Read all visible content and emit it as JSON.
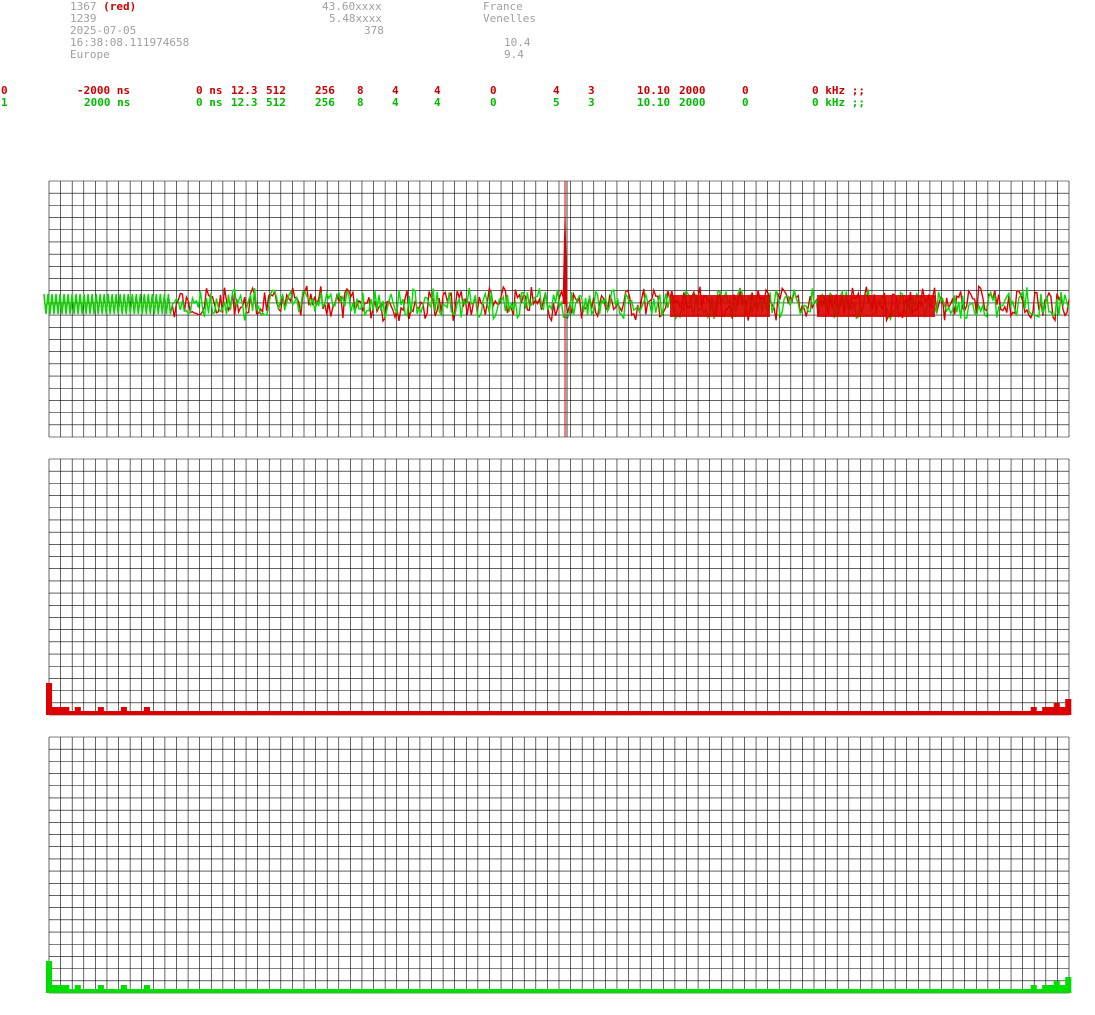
{
  "header": {
    "station_id": "1367",
    "station_id_red_tag": "(red)",
    "station_num": "1239",
    "date": "2025-07-05",
    "time": "16:38:08.111974658",
    "region": "Europe",
    "lat": "43.60xxxx",
    "lon": "5.48xxxx",
    "alt": "378",
    "country": "France",
    "city": "Venelles",
    "val1": "10.4",
    "val2": "9.4"
  },
  "channels": [
    {
      "idx": "0",
      "c1": "-2000 ns",
      "c2": "0 ns",
      "c3": "12.3",
      "c4": "512",
      "c5": "256",
      "c6": "8",
      "c7": "4",
      "c8": "4",
      "c9": "0",
      "c10": "4",
      "c11": "3",
      "c12": "10.10",
      "c13": "2000",
      "c14": "0",
      "c15": "0 kHz ;;"
    },
    {
      "idx": "1",
      "c1": "2000 ns",
      "c2": "0 ns",
      "c3": "12.3",
      "c4": "512",
      "c5": "256",
      "c6": "8",
      "c7": "4",
      "c8": "4",
      "c9": "0",
      "c10": "5",
      "c11": "3",
      "c12": "10.10",
      "c13": "2000",
      "c14": "0",
      "c15": "0 kHz ;;"
    }
  ],
  "colors": {
    "ch0": "#dd0000",
    "ch1": "#00dd00",
    "grid": "#000000"
  },
  "chart_data": [
    {
      "type": "line",
      "series": [
        {
          "values": []
        },
        {
          "values": []
        }
      ],
      "spike_x": 0.5,
      "grid": true
    },
    {
      "type": "bar",
      "values": [
        8,
        2,
        2,
        2,
        1,
        2,
        1,
        1,
        1,
        2,
        1,
        1,
        1,
        2,
        1,
        1,
        1,
        2,
        1,
        1,
        1,
        1,
        1,
        1,
        1,
        1,
        1,
        1,
        1,
        1,
        1,
        1,
        1,
        1,
        1,
        1,
        1,
        1,
        1,
        1,
        1,
        1,
        1,
        1,
        1,
        1,
        1,
        1,
        1,
        1,
        1,
        1,
        1,
        1,
        1,
        1,
        1,
        1,
        1,
        1,
        1,
        1,
        1,
        1,
        1,
        1,
        1,
        1,
        1,
        1,
        1,
        1,
        1,
        1,
        1,
        1,
        1,
        1,
        1,
        1,
        1,
        1,
        1,
        1,
        1,
        1,
        1,
        1,
        1,
        1,
        1,
        1,
        1,
        1,
        1,
        1,
        1,
        1,
        1,
        1,
        1,
        1,
        1,
        1,
        1,
        1,
        1,
        1,
        1,
        1,
        1,
        1,
        1,
        1,
        1,
        1,
        1,
        1,
        1,
        1,
        1,
        1,
        1,
        1,
        1,
        1,
        1,
        1,
        1,
        1,
        1,
        1,
        1,
        1,
        1,
        1,
        1,
        1,
        1,
        1,
        1,
        1,
        1,
        1,
        1,
        1,
        1,
        1,
        1,
        1,
        1,
        1,
        1,
        1,
        1,
        1,
        1,
        1,
        1,
        1,
        1,
        1,
        1,
        1,
        1,
        1,
        1,
        1,
        1,
        1,
        1,
        2,
        1,
        2,
        2,
        3,
        2,
        4
      ],
      "grid": true
    },
    {
      "type": "bar",
      "values": [
        8,
        2,
        2,
        2,
        1,
        2,
        1,
        1,
        1,
        2,
        1,
        1,
        1,
        2,
        1,
        1,
        1,
        2,
        1,
        1,
        1,
        1,
        1,
        1,
        1,
        1,
        1,
        1,
        1,
        1,
        1,
        1,
        1,
        1,
        1,
        1,
        1,
        1,
        1,
        1,
        1,
        1,
        1,
        1,
        1,
        1,
        1,
        1,
        1,
        1,
        1,
        1,
        1,
        1,
        1,
        1,
        1,
        1,
        1,
        1,
        1,
        1,
        1,
        1,
        1,
        1,
        1,
        1,
        1,
        1,
        1,
        1,
        1,
        1,
        1,
        1,
        1,
        1,
        1,
        1,
        1,
        1,
        1,
        1,
        1,
        1,
        1,
        1,
        1,
        1,
        1,
        1,
        1,
        1,
        1,
        1,
        1,
        1,
        1,
        1,
        1,
        1,
        1,
        1,
        1,
        1,
        1,
        1,
        1,
        1,
        1,
        1,
        1,
        1,
        1,
        1,
        1,
        1,
        1,
        1,
        1,
        1,
        1,
        1,
        1,
        1,
        1,
        1,
        1,
        1,
        1,
        1,
        1,
        1,
        1,
        1,
        1,
        1,
        1,
        1,
        1,
        1,
        1,
        1,
        1,
        1,
        1,
        1,
        1,
        1,
        1,
        1,
        1,
        1,
        1,
        1,
        1,
        1,
        1,
        1,
        1,
        1,
        1,
        1,
        1,
        1,
        1,
        1,
        1,
        1,
        1,
        2,
        1,
        2,
        2,
        3,
        2,
        4
      ],
      "grid": true
    }
  ]
}
